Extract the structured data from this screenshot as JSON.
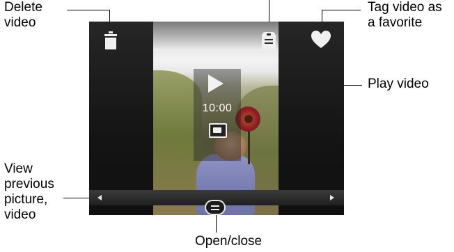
{
  "callouts": {
    "delete": [
      "Delete",
      "video"
    ],
    "favorite": [
      "Tag video as",
      "a favorite"
    ],
    "play": "Play video",
    "previous": [
      "View",
      "previous",
      "picture,",
      "video"
    ],
    "menu": "Open/close"
  },
  "video": {
    "duration": "10:00"
  },
  "icons": {
    "trash": "trash-icon",
    "tag": "tag-icon",
    "heart": "heart-icon",
    "play": "play-icon",
    "video_badge": "video-icon",
    "scroll_left": "arrow-left-icon",
    "scroll_right": "arrow-right-icon",
    "menu": "menu-icon"
  },
  "colors": {
    "screen_bg": "#0d0d0d",
    "icon": "#f0f0f0",
    "label": "#000000"
  }
}
